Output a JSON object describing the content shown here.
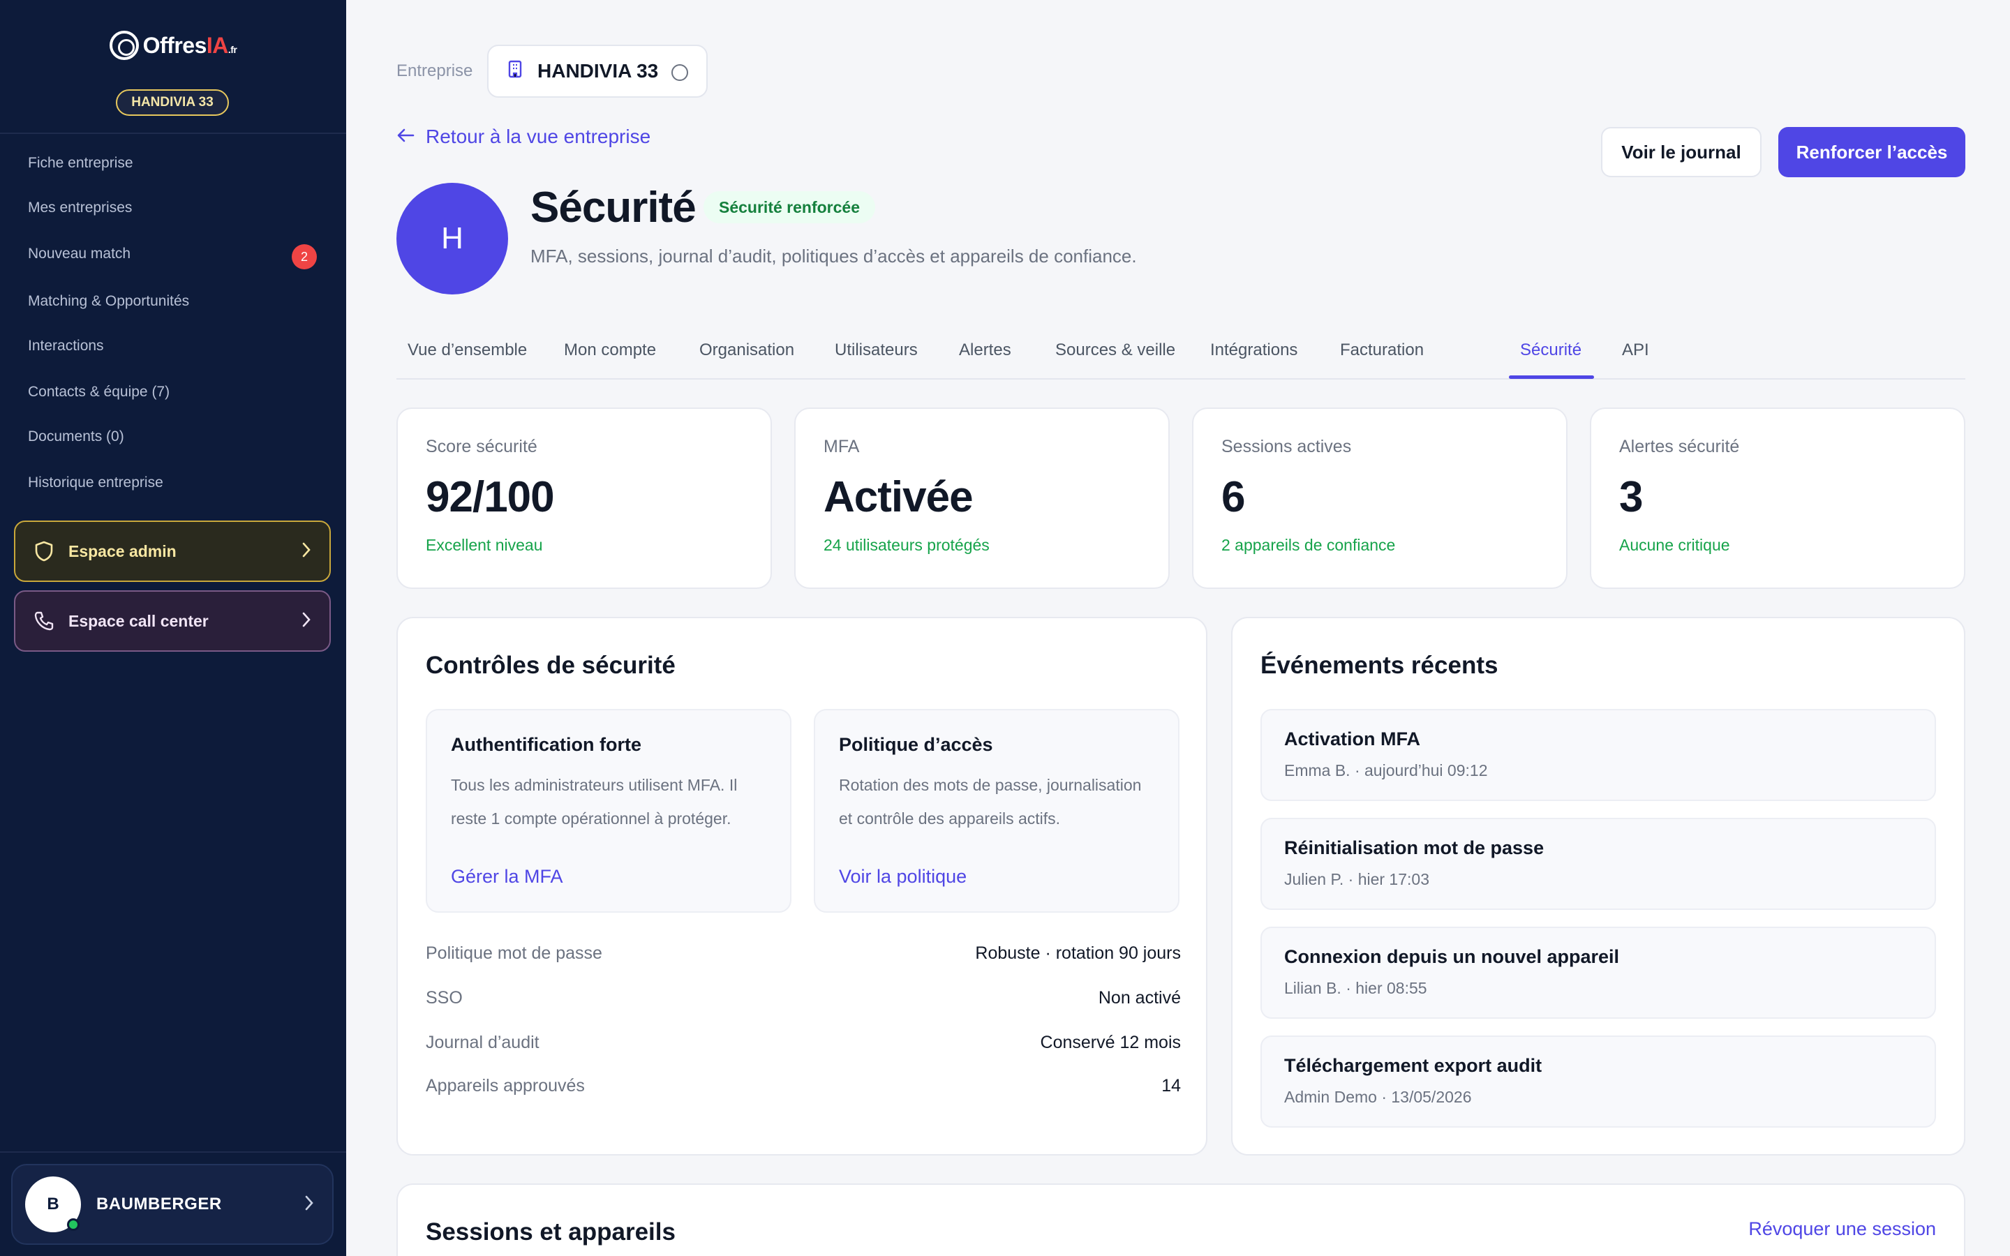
{
  "sidebar": {
    "logo": {
      "name": "Offres",
      "accent": "IA",
      "suffix": ".fr"
    },
    "company_pill": "HANDIVIA 33",
    "items": [
      {
        "label": "Fiche entreprise"
      },
      {
        "label": "Mes entreprises"
      },
      {
        "label": "Nouveau match",
        "badge": "2"
      },
      {
        "label": "Matching & Opportunités"
      },
      {
        "label": "Interactions"
      },
      {
        "label": "Contacts & équipe (7)"
      },
      {
        "label": "Documents (0)"
      },
      {
        "label": "Historique entreprise"
      }
    ],
    "admin_space": "Espace admin",
    "call_center_space": "Espace call center",
    "user": {
      "initial": "B",
      "name": "BAUMBERGER"
    }
  },
  "header": {
    "company_label": "Entreprise",
    "company_value": "HANDIVIA 33",
    "back_link": "Retour à la vue entreprise",
    "journal_button": "Voir le journal",
    "reinforce_button": "Renforcer l’accès",
    "avatar_initial": "H",
    "title": "Sécurité",
    "badge": "Sécurité renforcée",
    "subtitle": "MFA, sessions, journal d’audit, politiques d’accès et appareils de confiance."
  },
  "tabs": [
    {
      "label": "Vue d’ensemble"
    },
    {
      "label": "Mon compte"
    },
    {
      "label": "Organisation"
    },
    {
      "label": "Utilisateurs"
    },
    {
      "label": "Alertes"
    },
    {
      "label": "Sources & veille"
    },
    {
      "label": "Intégrations"
    },
    {
      "label": "Facturation"
    },
    {
      "label": "Sécurité",
      "active": true
    },
    {
      "label": "API"
    }
  ],
  "stats": [
    {
      "label": "Score sécurité",
      "value": "92/100",
      "sub": "Excellent niveau"
    },
    {
      "label": "MFA",
      "value": "Activée",
      "sub": "24 utilisateurs protégés"
    },
    {
      "label": "Sessions actives",
      "value": "6",
      "sub": "2 appareils de confiance"
    },
    {
      "label": "Alertes sécurité",
      "value": "3",
      "sub": "Aucune critique"
    }
  ],
  "controls": {
    "title": "Contrôles de sécurité",
    "cards": [
      {
        "title": "Authentification forte",
        "desc": "Tous les administrateurs utilisent MFA. Il reste 1 compte opérationnel à protéger.",
        "link": "Gérer la MFA"
      },
      {
        "title": "Politique d’accès",
        "desc": "Rotation des mots de passe, journalisation et contrôle des appareils actifs.",
        "link": "Voir la politique"
      }
    ],
    "rows": [
      {
        "key": "Politique mot de passe",
        "value": "Robuste · rotation 90 jours"
      },
      {
        "key": "SSO",
        "value": "Non activé"
      },
      {
        "key": "Journal d’audit",
        "value": "Conservé 12 mois"
      },
      {
        "key": "Appareils approuvés",
        "value": "14"
      }
    ]
  },
  "events": {
    "title": "Événements récents",
    "items": [
      {
        "title": "Activation MFA",
        "meta": "Emma B. · aujourd’hui 09:12"
      },
      {
        "title": "Réinitialisation mot de passe",
        "meta": "Julien P. · hier 17:03"
      },
      {
        "title": "Connexion depuis un nouvel appareil",
        "meta": "Lilian B. · hier 08:55"
      },
      {
        "title": "Téléchargement export audit",
        "meta": "Admin Demo · 13/05/2026"
      }
    ]
  },
  "sessions": {
    "title": "Sessions et appareils",
    "revoke_link": "Révoquer une session"
  },
  "colors": {
    "accent": "#4f46e5",
    "sidebar": "#0d1b3a",
    "success": "#16a34a",
    "danger": "#ef4444"
  }
}
